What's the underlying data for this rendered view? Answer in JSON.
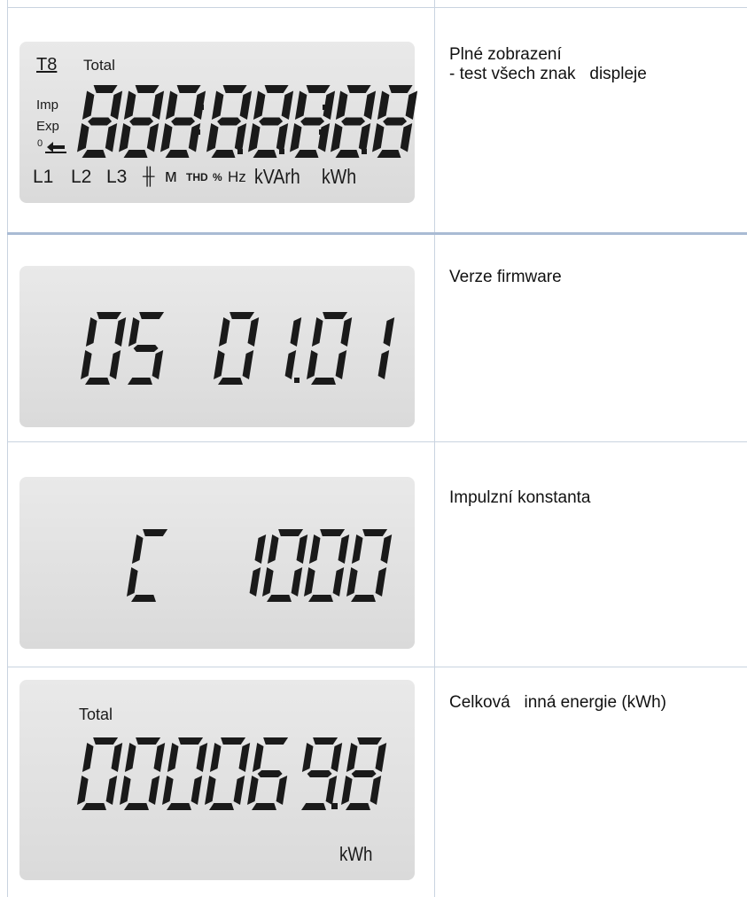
{
  "rows": [
    {
      "description": [
        "Plné zobrazení",
        "- test všech znak   displeje"
      ],
      "lcd": {
        "tariff": "T8",
        "total": "Total",
        "left_labels": [
          "Imp",
          "Exp",
          "0"
        ],
        "digits": "88888888",
        "indicators": [
          "L1",
          "L2",
          "L3",
          "╫",
          "ᴍ",
          "THD",
          "%",
          "Hz",
          "kVArh",
          "kWh"
        ]
      }
    },
    {
      "description": [
        "Verze firmware"
      ],
      "lcd": {
        "digits": "05 01.01"
      }
    },
    {
      "description": [
        "Impulzní konstanta"
      ],
      "lcd": {
        "digits": "C 1000"
      }
    },
    {
      "description": [
        "Celková   inná energie (kWh)"
      ],
      "lcd": {
        "total": "Total",
        "digits": "0000698",
        "unit": "kWh"
      }
    }
  ]
}
